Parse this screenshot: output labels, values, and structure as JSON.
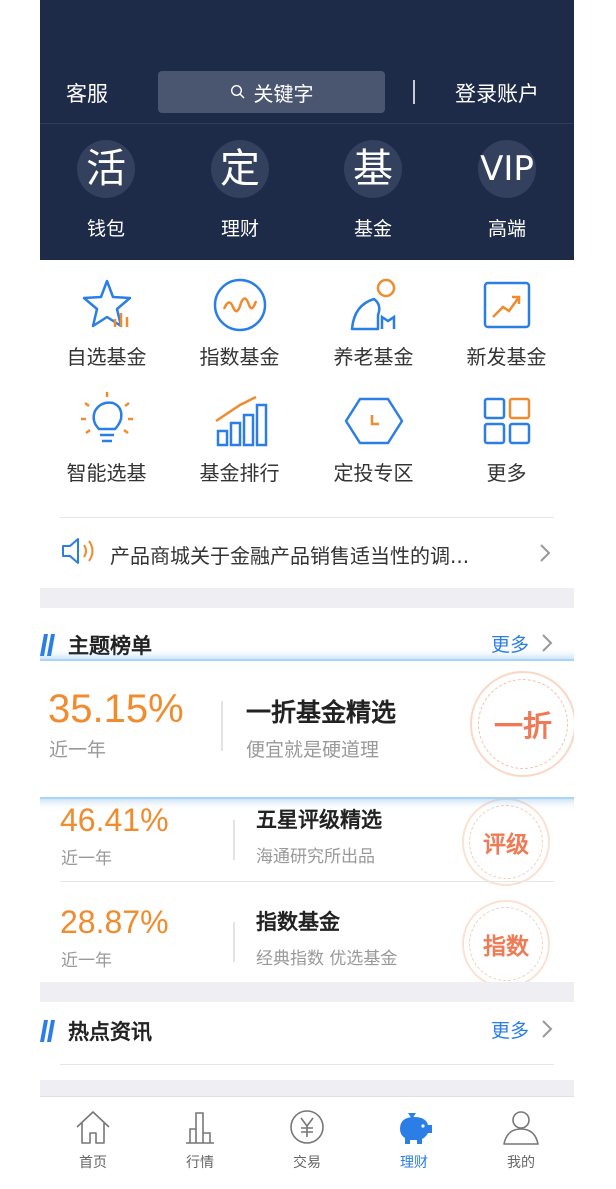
{
  "header": {
    "service_label": "客服",
    "search_placeholder": "关键字",
    "login_label": "登录账户",
    "items": [
      {
        "glyph": "活",
        "label": "钱包",
        "icon": "wallet-icon"
      },
      {
        "glyph": "定",
        "label": "理财",
        "icon": "finance-icon"
      },
      {
        "glyph": "基",
        "label": "基金",
        "icon": "fund-icon"
      },
      {
        "glyph": "VIP",
        "label": "高端",
        "icon": "vip-icon"
      }
    ]
  },
  "grid": [
    {
      "label": "自选基金",
      "icon": "star-chart-icon"
    },
    {
      "label": "指数基金",
      "icon": "wave-circle-icon"
    },
    {
      "label": "养老基金",
      "icon": "elderly-person-icon"
    },
    {
      "label": "新发基金",
      "icon": "trend-up-icon"
    },
    {
      "label": "智能选基",
      "icon": "lightbulb-icon"
    },
    {
      "label": "基金排行",
      "icon": "ranking-bars-icon"
    },
    {
      "label": "定投专区",
      "icon": "hexagon-clock-icon"
    },
    {
      "label": "更多",
      "icon": "grid-more-icon"
    }
  ],
  "notice": {
    "text": "产品商城关于金融产品销售适当性的调..."
  },
  "themes": {
    "title": "主题榜单",
    "more_label": "更多",
    "featured": {
      "pct": "35.15%",
      "period": "近一年",
      "name": "一折基金精选",
      "desc": "便宜就是硬道理",
      "badge": "一折"
    },
    "rows": [
      {
        "pct": "46.41%",
        "period": "近一年",
        "name": "五星评级精选",
        "desc": "海通研究所出品",
        "badge": "评级"
      },
      {
        "pct": "28.87%",
        "period": "近一年",
        "name": "指数基金",
        "desc": "经典指数 优选基金",
        "badge": "指数"
      }
    ]
  },
  "news": {
    "title": "热点资讯",
    "more_label": "更多"
  },
  "tabbar": [
    {
      "label": "首页",
      "icon": "home-icon"
    },
    {
      "label": "行情",
      "icon": "market-icon"
    },
    {
      "label": "交易",
      "icon": "yen-trade-icon"
    },
    {
      "label": "理财",
      "icon": "piggy-bank-icon",
      "active": true
    },
    {
      "label": "我的",
      "icon": "profile-icon"
    }
  ],
  "colors": {
    "header_bg": "#1e2b48",
    "accent_blue": "#2a7ee5",
    "accent_orange": "#f08b2e",
    "badge_red": "#ef7b56"
  }
}
